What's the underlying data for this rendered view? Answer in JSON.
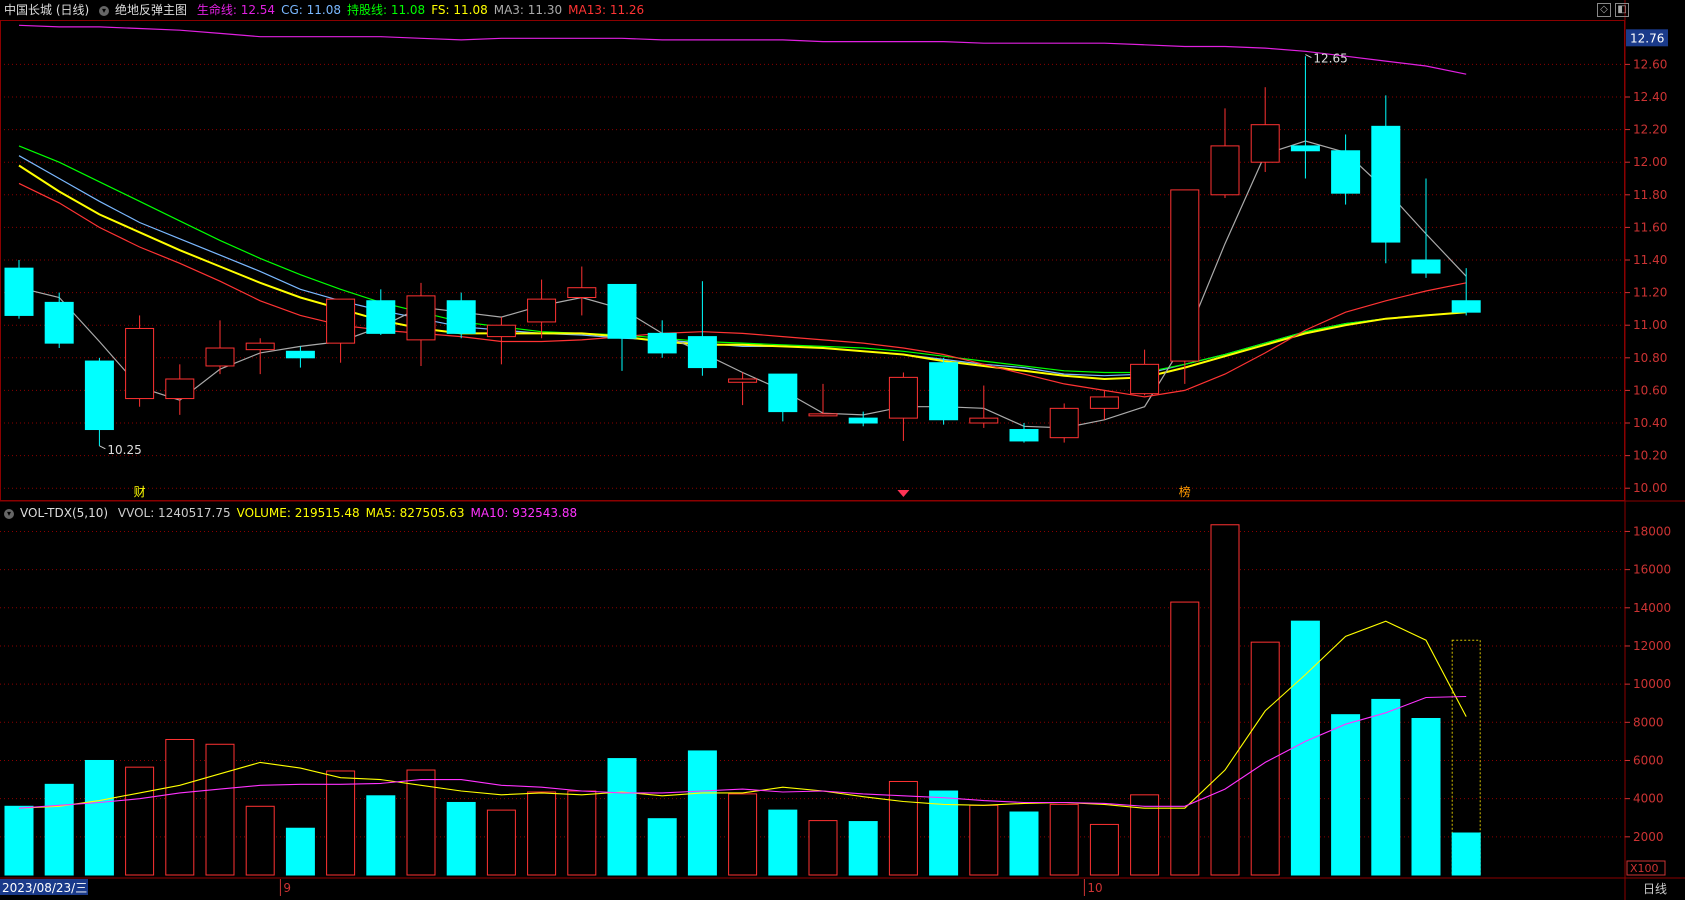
{
  "header": {
    "title": "中国长城 (日线)",
    "indicator_name": "绝地反弹主图",
    "items": [
      {
        "label": "生命线:",
        "value": "12.54",
        "color": "#e020e0"
      },
      {
        "label": "CG:",
        "value": "11.08",
        "color": "#7ab8ff"
      },
      {
        "label": "持股线:",
        "value": "11.08",
        "color": "#00ff00"
      },
      {
        "label": "FS:",
        "value": "11.08",
        "color": "#ffff00"
      },
      {
        "label": "MA3:",
        "value": "11.30",
        "color": "#aaaaaa"
      },
      {
        "label": "MA13:",
        "value": "11.26",
        "color": "#ff3333"
      }
    ]
  },
  "vol_header": {
    "name": "VOL-TDX(5,10)",
    "items": [
      {
        "label": "VVOL:",
        "value": "1240517.75",
        "color": "#cccccc"
      },
      {
        "label": "VOLUME:",
        "value": "219515.48",
        "color": "#ffff00"
      },
      {
        "label": "MA5:",
        "value": "827505.63",
        "color": "#ffff00"
      },
      {
        "label": "MA10:",
        "value": "932543.88",
        "color": "#ff33ff"
      }
    ]
  },
  "chart_data": [
    {
      "type": "candlestick",
      "y_ticks": [
        "10.00",
        "10.20",
        "10.40",
        "10.60",
        "10.80",
        "11.00",
        "11.20",
        "11.40",
        "11.60",
        "11.80",
        "12.00",
        "12.20",
        "12.40",
        "12.60"
      ],
      "ylim": [
        9.94,
        12.86
      ],
      "current_price_label": "12.76",
      "annotations": [
        {
          "text": "10.25",
          "x_index": 2,
          "y": 10.26,
          "type": "low"
        },
        {
          "text": "12.65",
          "x_index": 32,
          "y": 12.66,
          "type": "high"
        }
      ],
      "event_markers": [
        {
          "text": "财",
          "x_index": 3,
          "color": "#ffff00"
        },
        {
          "text": "榜",
          "x_index": 29,
          "color": "#ff9900"
        }
      ],
      "candles": [
        {
          "o": 11.35,
          "h": 11.4,
          "c": 11.06,
          "l": 11.04
        },
        {
          "o": 11.14,
          "h": 11.2,
          "c": 10.89,
          "l": 10.86
        },
        {
          "o": 10.78,
          "h": 10.8,
          "c": 10.36,
          "l": 10.26
        },
        {
          "o": 10.55,
          "h": 11.06,
          "c": 10.98,
          "l": 10.5
        },
        {
          "o": 10.55,
          "h": 10.76,
          "c": 10.67,
          "l": 10.45
        },
        {
          "o": 10.75,
          "h": 11.03,
          "c": 10.86,
          "l": 10.7
        },
        {
          "o": 10.85,
          "h": 10.92,
          "c": 10.89,
          "l": 10.7
        },
        {
          "o": 10.84,
          "h": 10.87,
          "c": 10.8,
          "l": 10.74
        },
        {
          "o": 10.89,
          "h": 11.12,
          "c": 11.16,
          "l": 10.77
        },
        {
          "o": 11.15,
          "h": 11.22,
          "c": 10.95,
          "l": 10.94
        },
        {
          "o": 10.91,
          "h": 11.26,
          "c": 11.18,
          "l": 10.75
        },
        {
          "o": 11.15,
          "h": 11.2,
          "c": 10.95,
          "l": 10.92
        },
        {
          "o": 10.93,
          "h": 11.05,
          "c": 11.0,
          "l": 10.76
        },
        {
          "o": 11.02,
          "h": 11.28,
          "c": 11.16,
          "l": 10.92
        },
        {
          "o": 11.17,
          "h": 11.36,
          "c": 11.23,
          "l": 11.06
        },
        {
          "o": 11.25,
          "h": 11.25,
          "c": 10.92,
          "l": 10.72
        },
        {
          "o": 10.95,
          "h": 11.03,
          "c": 10.83,
          "l": 10.8
        },
        {
          "o": 10.93,
          "h": 11.27,
          "c": 10.74,
          "l": 10.69
        },
        {
          "o": 10.65,
          "h": 10.71,
          "c": 10.67,
          "l": 10.51
        },
        {
          "o": 10.7,
          "h": 10.69,
          "c": 10.47,
          "l": 10.41
        },
        {
          "o": 10.45,
          "h": 10.64,
          "c": 10.45,
          "l": 10.44
        },
        {
          "o": 10.43,
          "h": 10.47,
          "c": 10.4,
          "l": 10.38
        },
        {
          "o": 10.43,
          "h": 10.71,
          "c": 10.68,
          "l": 10.29
        },
        {
          "o": 10.77,
          "h": 10.8,
          "c": 10.42,
          "l": 10.39
        },
        {
          "o": 10.4,
          "h": 10.63,
          "c": 10.43,
          "l": 10.37
        },
        {
          "o": 10.36,
          "h": 10.4,
          "c": 10.29,
          "l": 10.28
        },
        {
          "o": 10.31,
          "h": 10.52,
          "c": 10.49,
          "l": 10.28
        },
        {
          "o": 10.49,
          "h": 10.6,
          "c": 10.56,
          "l": 10.42
        },
        {
          "o": 10.58,
          "h": 10.85,
          "c": 10.76,
          "l": 10.57
        },
        {
          "o": 10.78,
          "h": 11.83,
          "c": 11.83,
          "l": 10.64
        },
        {
          "o": 11.8,
          "h": 12.33,
          "c": 12.1,
          "l": 11.78
        },
        {
          "o": 12.0,
          "h": 12.46,
          "c": 12.23,
          "l": 11.94
        },
        {
          "o": 12.1,
          "h": 12.65,
          "c": 12.07,
          "l": 11.9
        },
        {
          "o": 12.07,
          "h": 12.17,
          "c": 11.81,
          "l": 11.74
        },
        {
          "o": 12.22,
          "h": 12.41,
          "c": 11.51,
          "l": 11.38
        },
        {
          "o": 11.4,
          "h": 11.9,
          "c": 11.32,
          "l": 11.29
        },
        {
          "o": 11.15,
          "h": 11.35,
          "c": 11.08,
          "l": 11.06
        }
      ],
      "series": [
        {
          "name": "生命线",
          "color": "#e020e0",
          "values": [
            12.84,
            12.83,
            12.83,
            12.82,
            12.81,
            12.79,
            12.77,
            12.77,
            12.77,
            12.77,
            12.76,
            12.75,
            12.76,
            12.76,
            12.76,
            12.76,
            12.75,
            12.75,
            12.75,
            12.75,
            12.74,
            12.74,
            12.74,
            12.74,
            12.73,
            12.73,
            12.73,
            12.73,
            12.72,
            12.71,
            12.71,
            12.7,
            12.68,
            12.65,
            12.62,
            12.59,
            12.54
          ]
        },
        {
          "name": "CG",
          "color": "#7ab8ff",
          "values": [
            12.04,
            11.9,
            11.76,
            11.63,
            11.53,
            11.43,
            11.33,
            11.22,
            11.15,
            11.09,
            11.04,
            10.99,
            10.97,
            10.95,
            10.94,
            10.92,
            10.91,
            10.89,
            10.87,
            10.87,
            10.86,
            10.84,
            10.82,
            10.79,
            10.76,
            10.74,
            10.7,
            10.69,
            10.7,
            10.76,
            10.82,
            10.89,
            10.96,
            11.01,
            11.04,
            11.06,
            11.08
          ]
        },
        {
          "name": "持股线",
          "color": "#00ff00",
          "values": [
            12.1,
            12.0,
            11.88,
            11.76,
            11.64,
            11.52,
            11.41,
            11.31,
            11.22,
            11.14,
            11.08,
            11.02,
            10.99,
            10.96,
            10.95,
            10.94,
            10.92,
            10.9,
            10.89,
            10.88,
            10.87,
            10.86,
            10.84,
            10.81,
            10.78,
            10.75,
            10.72,
            10.71,
            10.71,
            10.76,
            10.82,
            10.89,
            10.96,
            11.01,
            11.04,
            11.06,
            11.08
          ]
        },
        {
          "name": "FS",
          "color": "#ffff00",
          "values": [
            11.98,
            11.82,
            11.68,
            11.57,
            11.46,
            11.36,
            11.26,
            11.17,
            11.1,
            11.03,
            10.98,
            10.95,
            10.95,
            10.95,
            10.95,
            10.93,
            10.9,
            10.88,
            10.88,
            10.87,
            10.86,
            10.84,
            10.82,
            10.78,
            10.75,
            10.72,
            10.69,
            10.67,
            10.68,
            10.74,
            10.81,
            10.88,
            10.95,
            11.0,
            11.04,
            11.06,
            11.08
          ]
        },
        {
          "name": "MA3",
          "color": "#aaaaaa",
          "values": [
            11.23,
            11.17,
            10.9,
            10.62,
            10.54,
            10.73,
            10.83,
            10.87,
            10.9,
            10.99,
            11.11,
            11.08,
            11.05,
            11.12,
            11.17,
            11.1,
            10.95,
            10.83,
            10.71,
            10.6,
            10.46,
            10.45,
            10.5,
            10.5,
            10.49,
            10.38,
            10.37,
            10.42,
            10.5,
            10.9,
            11.5,
            12.05,
            12.13,
            12.06,
            11.83,
            11.56,
            11.3
          ]
        },
        {
          "name": "MA13",
          "color": "#ff3333",
          "values": [
            11.87,
            11.75,
            11.6,
            11.48,
            11.38,
            11.27,
            11.15,
            11.06,
            11.0,
            10.97,
            10.95,
            10.93,
            10.9,
            10.9,
            10.91,
            10.93,
            10.95,
            10.96,
            10.95,
            10.93,
            10.91,
            10.89,
            10.86,
            10.82,
            10.76,
            10.7,
            10.64,
            10.6,
            10.56,
            10.6,
            10.7,
            10.83,
            10.97,
            11.08,
            11.15,
            11.21,
            11.26
          ]
        }
      ]
    },
    {
      "type": "bar",
      "y_ticks": [
        "2000",
        "4000",
        "6000",
        "8000",
        "10000",
        "12000",
        "14000",
        "16000",
        "18000"
      ],
      "ylim": [
        0,
        18600
      ],
      "unit_label": "X100",
      "volumes": [
        3600,
        4750,
        6000,
        5650,
        7100,
        6850,
        3600,
        2450,
        5450,
        4150,
        5500,
        3800,
        3400,
        4350,
        4400,
        6100,
        2950,
        6500,
        4250,
        3400,
        2850,
        2800,
        4900,
        4400,
        3650,
        3300,
        3700,
        2650,
        4200,
        14300,
        18350,
        12200,
        13300,
        8400,
        9200,
        8200,
        2200
      ],
      "ma5": [
        3500,
        3600,
        3900,
        4300,
        4700,
        5300,
        5900,
        5600,
        5100,
        5000,
        4700,
        4400,
        4200,
        4300,
        4200,
        4350,
        4150,
        4300,
        4300,
        4600,
        4400,
        4100,
        3850,
        3700,
        3650,
        3750,
        3800,
        3700,
        3500,
        3500,
        5500,
        8600,
        10500,
        12500,
        13300,
        12300,
        8300
      ],
      "ma10": [
        3500,
        3650,
        3800,
        4000,
        4300,
        4500,
        4700,
        4750,
        4750,
        4800,
        5000,
        5000,
        4700,
        4600,
        4400,
        4300,
        4300,
        4400,
        4500,
        4350,
        4400,
        4250,
        4150,
        4050,
        3900,
        3800,
        3800,
        3750,
        3600,
        3600,
        4500,
        5900,
        7000,
        7900,
        8500,
        9300,
        9350
      ]
    }
  ],
  "x_axis": {
    "date_label": "2023/08/23/三",
    "month_labels": [
      {
        "text": "9",
        "x_index": 7
      },
      {
        "text": "10",
        "x_index": 27
      }
    ]
  },
  "corner_label": "日线",
  "colors": {
    "up": "#ff3232",
    "down": "#00ffff",
    "grid": "#8b0000",
    "axis_text": "#cc3333"
  }
}
